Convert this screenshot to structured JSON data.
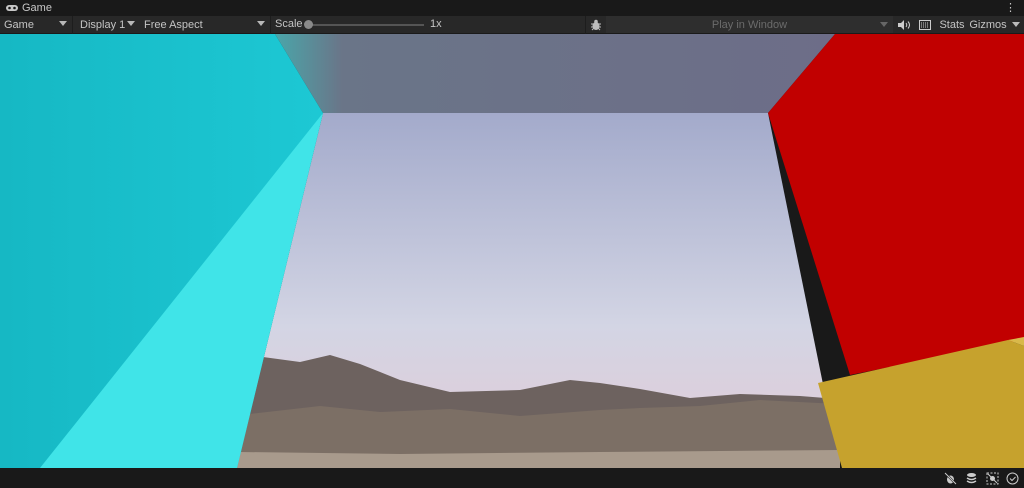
{
  "tab": {
    "title": "Game",
    "icon": "gamepad-icon"
  },
  "toolbar": {
    "view_mode": "Game",
    "display": "Display 1",
    "aspect": "Free Aspect",
    "scale_label": "Scale",
    "scale_value": "1x",
    "play_mode": "Play in Window",
    "stats_label": "Stats",
    "gizmos_label": "Gizmos"
  },
  "status_icons": [
    "debug-off-icon",
    "layers-icon",
    "visibility-off-icon",
    "check-circle-icon"
  ],
  "colors": {
    "cyan": "#19c3cf",
    "cyan_light": "#40e4e8",
    "red": "#c10000",
    "yellow": "#c9a42c",
    "ceiling": "#6c6f86"
  }
}
